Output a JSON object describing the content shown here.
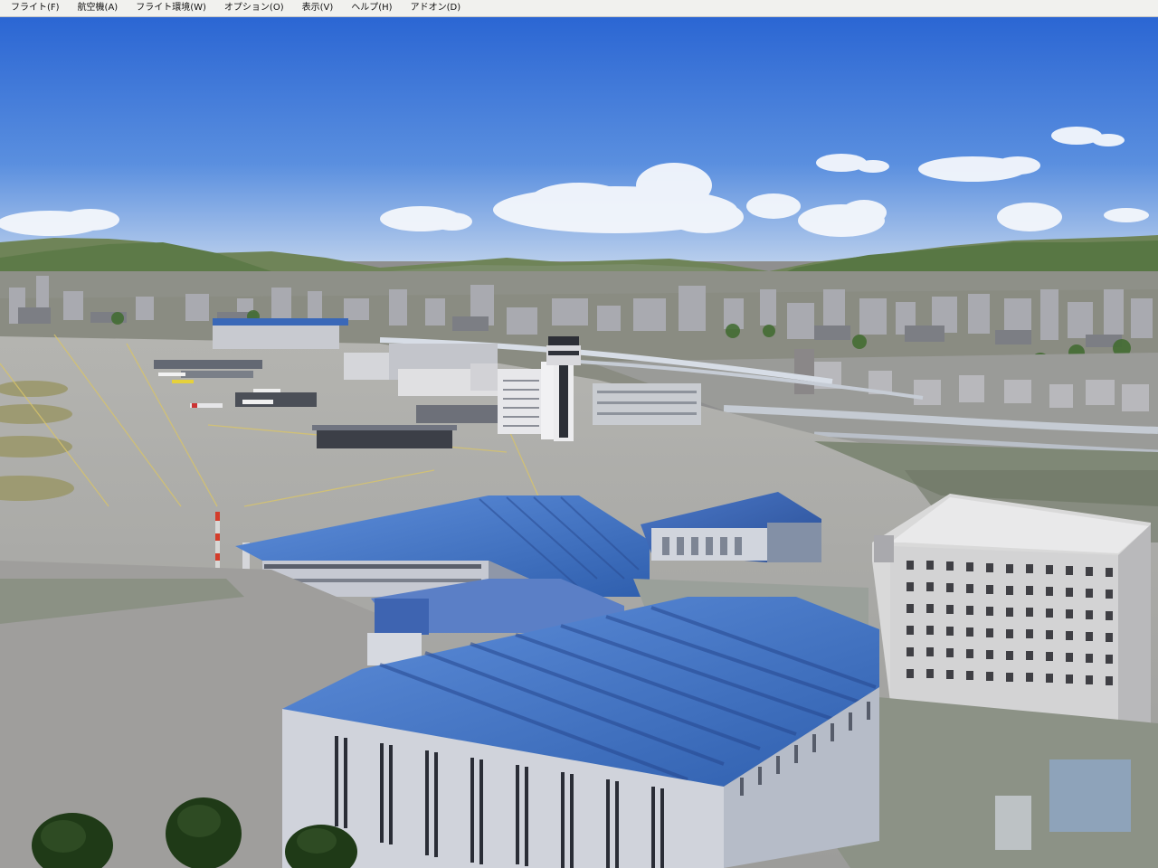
{
  "app": {
    "menu": [
      {
        "label": "フライト(F)"
      },
      {
        "label": "航空機(A)"
      },
      {
        "label": "フライト環境(W)"
      },
      {
        "label": "オプション(O)"
      },
      {
        "label": "表示(V)"
      },
      {
        "label": "ヘルプ(H)"
      },
      {
        "label": "アドオン(D)"
      }
    ]
  },
  "scene": {
    "colors": {
      "sky_top": "#2f6fd6",
      "sky_horizon": "#a9c6ec",
      "hills": "#5c7a45",
      "apron": "#a7a7a7",
      "grass": "#8a8f6e",
      "hangar_roof": "#3f72c4",
      "hangar_wall": "#c9ccd6",
      "tower": "#e8e8ea"
    }
  }
}
